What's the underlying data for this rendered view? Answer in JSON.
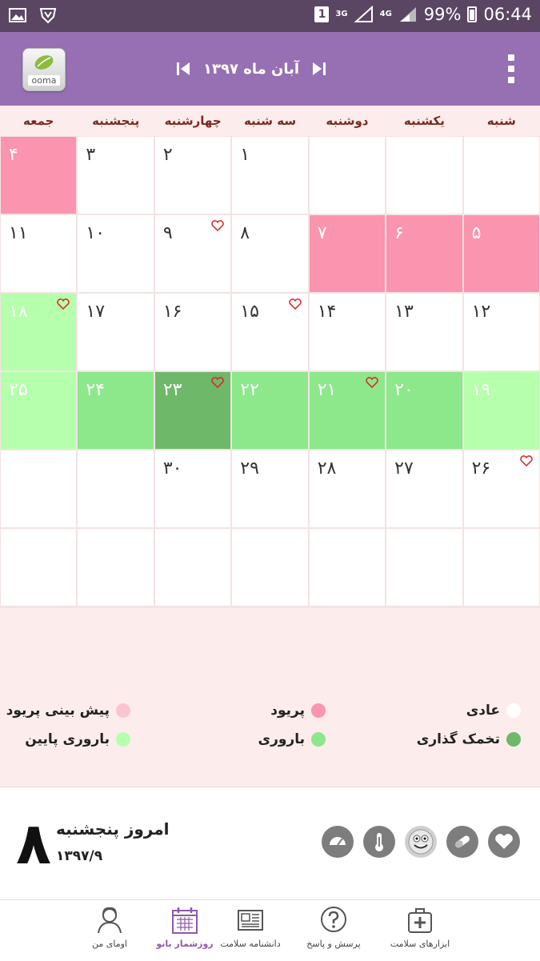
{
  "status_bar": {
    "sim": "1",
    "net1": "3G",
    "net2": "4G",
    "battery": "99%",
    "time": "06:44"
  },
  "header": {
    "logo_text": "ooma",
    "month_title": "آبان ماه ۱۳۹۷"
  },
  "weekdays": [
    "شنبه",
    "یکشنبه",
    "دوشنبه",
    "سه شنبه",
    "چهارشنبه",
    "پنجشنبه",
    "جمعه"
  ],
  "calendar": {
    "rows": [
      [
        {
          "n": "",
          "c": ""
        },
        {
          "n": "",
          "c": ""
        },
        {
          "n": "",
          "c": ""
        },
        {
          "n": "",
          "c": ""
        },
        {
          "n": "۱",
          "c": ""
        },
        {
          "n": "۲",
          "c": ""
        },
        {
          "n": "۳",
          "c": ""
        },
        {
          "n": "۴",
          "c": "pink"
        }
      ],
      [
        {
          "n": "۵",
          "c": "pink"
        },
        {
          "n": "۶",
          "c": "pink"
        },
        {
          "n": "۷",
          "c": "pink"
        },
        {
          "n": "۸",
          "c": ""
        },
        {
          "n": "۹",
          "c": "",
          "h": true
        },
        {
          "n": "۱۰",
          "c": ""
        },
        {
          "n": "۱۱",
          "c": ""
        }
      ],
      [
        {
          "n": "۱۲",
          "c": ""
        },
        {
          "n": "۱۳",
          "c": ""
        },
        {
          "n": "۱۴",
          "c": ""
        },
        {
          "n": "۱۵",
          "c": "",
          "h": true
        },
        {
          "n": "۱۶",
          "c": ""
        },
        {
          "n": "۱۷",
          "c": ""
        },
        {
          "n": "۱۸",
          "c": "lgreen",
          "h": true
        }
      ],
      [
        {
          "n": "۱۹",
          "c": "lgreen"
        },
        {
          "n": "۲۰",
          "c": "green"
        },
        {
          "n": "۲۱",
          "c": "green",
          "h": true
        },
        {
          "n": "۲۲",
          "c": "green"
        },
        {
          "n": "۲۳",
          "c": "dgreen",
          "h": true
        },
        {
          "n": "۲۴",
          "c": "green"
        },
        {
          "n": "۲۵",
          "c": "lgreen"
        }
      ],
      [
        {
          "n": "۲۶",
          "c": "",
          "h": true
        },
        {
          "n": "۲۷",
          "c": ""
        },
        {
          "n": "۲۸",
          "c": ""
        },
        {
          "n": "۲۹",
          "c": ""
        },
        {
          "n": "۳۰",
          "c": ""
        },
        {
          "n": "",
          "c": ""
        },
        {
          "n": "",
          "c": ""
        }
      ],
      [
        {
          "n": "",
          "c": ""
        },
        {
          "n": "",
          "c": ""
        },
        {
          "n": "",
          "c": ""
        },
        {
          "n": "",
          "c": ""
        },
        {
          "n": "",
          "c": ""
        },
        {
          "n": "",
          "c": ""
        },
        {
          "n": "",
          "c": ""
        }
      ]
    ]
  },
  "legend": [
    {
      "label": "عادی",
      "color": "#ffffff"
    },
    {
      "label": "پریود",
      "color": "#fb94ae"
    },
    {
      "label": "پیش بینی پریود",
      "color": "#fcc4d2"
    },
    {
      "label": "تخمک گذاری",
      "color": "#6eb86a"
    },
    {
      "label": "باروری",
      "color": "#8ce88a"
    },
    {
      "label": "باروری پایین",
      "color": "#b6ffad"
    }
  ],
  "today": {
    "day_number": "۸",
    "label": "امروز پنجشنبه",
    "date": "۱۳۹۷/۹"
  },
  "tools": [
    "heart-icon",
    "pill-icon",
    "smiley-icon",
    "thermometer-icon",
    "scale-icon"
  ],
  "bottom_nav": [
    {
      "label": "ابزارهای سلامت",
      "icon": "medical-kit-icon"
    },
    {
      "label": "پرسش و پاسخ",
      "icon": "question-icon"
    },
    {
      "label": "دانشنامه سلامت",
      "icon": "newspaper-icon"
    },
    {
      "label": "روزشمار بانو",
      "icon": "calendar-icon",
      "active": true
    },
    {
      "label": "اومای من",
      "icon": "user-icon"
    }
  ],
  "colors": {
    "header": "#9670b3",
    "status": "#5a4663",
    "weekday_text": "#7b2a1f",
    "active_nav": "#8e5aaa"
  }
}
